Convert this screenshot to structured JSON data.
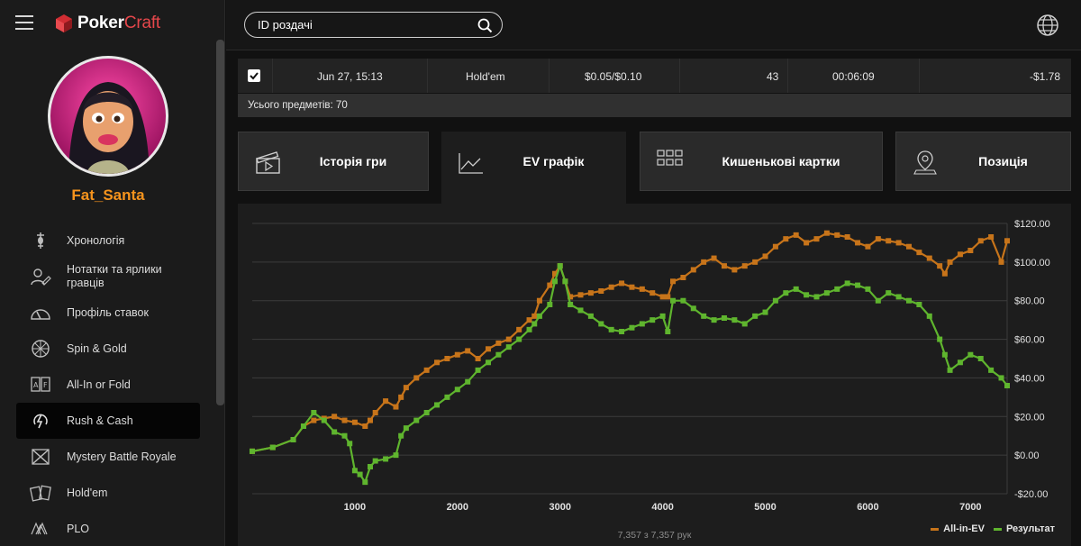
{
  "app": {
    "logo_primary": "Poker",
    "logo_accent": "Craft"
  },
  "profile": {
    "username": "Fat_Santa"
  },
  "sidebar": {
    "items": [
      {
        "label": "Хронологія",
        "icon": "hourglass-icon"
      },
      {
        "label": "Нотатки та ярлики гравців",
        "icon": "player-notes-icon"
      },
      {
        "label": "Профіль ставок",
        "icon": "gauge-icon"
      },
      {
        "label": "Spin & Gold",
        "icon": "spin-wheel-icon"
      },
      {
        "label": "All-In or Fold",
        "icon": "allin-cards-icon"
      },
      {
        "label": "Rush & Cash",
        "icon": "rush-icon",
        "active": true
      },
      {
        "label": "Mystery Battle Royale",
        "icon": "battle-royale-icon"
      },
      {
        "label": "Hold'em",
        "icon": "holdem-cards-icon"
      },
      {
        "label": "PLO",
        "icon": "plo-cards-icon"
      }
    ]
  },
  "search": {
    "placeholder": "ID роздачі"
  },
  "table": {
    "row": {
      "checked": true,
      "date": "Jun 27, 15:13",
      "game": "Hold'em",
      "stakes": "$0.05/$0.10",
      "hands": "43",
      "duration": "00:06:09",
      "result": "-$1.78"
    },
    "total_label": "Усього предметів: 70"
  },
  "tabs": [
    {
      "label": "Історія гри",
      "icon": "clapperboard-icon"
    },
    {
      "label": "EV графік",
      "icon": "line-chart-icon",
      "active": true
    },
    {
      "label": "Кишенькові картки",
      "icon": "grid-icon"
    },
    {
      "label": "Позиція",
      "icon": "location-pin-icon"
    }
  ],
  "colors": {
    "ev": "#c7741a",
    "result": "#5fb52e",
    "accent": "#f7941d"
  },
  "chart_data": {
    "type": "line",
    "x_ticks": [
      1000,
      2000,
      3000,
      4000,
      5000,
      6000,
      7000
    ],
    "y_ticks": [
      "$120.00",
      "$100.00",
      "$80.00",
      "$60.00",
      "$40.00",
      "$20.00",
      "$0.00",
      "-$20.00"
    ],
    "xlim": [
      0,
      7357
    ],
    "ylim": [
      -20,
      120
    ],
    "grid": true,
    "legend": "bottom-right",
    "footnote": "7,357 з 7,357 рук",
    "series": [
      {
        "name": "All-in-EV",
        "color": "#c7741a",
        "x": [
          0,
          200,
          400,
          500,
          600,
          700,
          800,
          900,
          1000,
          1100,
          1150,
          1200,
          1300,
          1400,
          1450,
          1500,
          1600,
          1700,
          1800,
          1900,
          2000,
          2100,
          2200,
          2300,
          2400,
          2500,
          2600,
          2700,
          2750,
          2800,
          2900,
          2950,
          3000,
          3050,
          3100,
          3200,
          3300,
          3400,
          3500,
          3600,
          3700,
          3800,
          3900,
          4000,
          4050,
          4100,
          4200,
          4300,
          4400,
          4500,
          4600,
          4700,
          4800,
          4900,
          5000,
          5100,
          5200,
          5300,
          5400,
          5500,
          5600,
          5700,
          5800,
          5900,
          6000,
          6100,
          6200,
          6300,
          6400,
          6500,
          6600,
          6700,
          6750,
          6800,
          6900,
          7000,
          7100,
          7200,
          7300,
          7357
        ],
        "y": [
          2,
          4,
          8,
          15,
          18,
          19,
          20,
          18,
          17,
          15,
          18,
          22,
          28,
          25,
          30,
          35,
          40,
          44,
          48,
          50,
          52,
          54,
          50,
          55,
          58,
          60,
          65,
          70,
          72,
          80,
          88,
          94,
          98,
          90,
          82,
          83,
          84,
          85,
          87,
          89,
          87,
          86,
          84,
          82,
          82,
          90,
          92,
          96,
          100,
          102,
          98,
          96,
          98,
          100,
          103,
          108,
          112,
          114,
          110,
          112,
          115,
          114,
          113,
          110,
          108,
          112,
          111,
          110,
          108,
          105,
          102,
          98,
          94,
          100,
          104,
          106,
          111,
          113,
          100,
          111
        ]
      },
      {
        "name": "Результат",
        "color": "#5fb52e",
        "x": [
          0,
          200,
          400,
          500,
          600,
          700,
          800,
          900,
          950,
          1000,
          1050,
          1100,
          1150,
          1200,
          1300,
          1400,
          1450,
          1500,
          1600,
          1700,
          1800,
          1900,
          2000,
          2100,
          2200,
          2300,
          2400,
          2500,
          2600,
          2700,
          2750,
          2800,
          2900,
          2950,
          3000,
          3050,
          3100,
          3200,
          3300,
          3400,
          3500,
          3600,
          3700,
          3800,
          3900,
          4000,
          4050,
          4100,
          4200,
          4300,
          4400,
          4500,
          4600,
          4700,
          4800,
          4900,
          5000,
          5100,
          5200,
          5300,
          5400,
          5500,
          5600,
          5700,
          5800,
          5900,
          6000,
          6100,
          6200,
          6300,
          6400,
          6500,
          6600,
          6700,
          6750,
          6800,
          6900,
          7000,
          7100,
          7200,
          7300,
          7357
        ],
        "y": [
          2,
          4,
          8,
          15,
          22,
          18,
          12,
          10,
          6,
          -8,
          -10,
          -14,
          -6,
          -3,
          -2,
          0,
          10,
          14,
          18,
          22,
          26,
          30,
          34,
          38,
          44,
          48,
          52,
          56,
          60,
          65,
          68,
          72,
          78,
          90,
          98,
          90,
          78,
          75,
          72,
          68,
          65,
          64,
          66,
          68,
          70,
          72,
          64,
          80,
          80,
          76,
          72,
          70,
          71,
          70,
          68,
          72,
          74,
          80,
          84,
          86,
          83,
          82,
          84,
          86,
          89,
          88,
          86,
          80,
          84,
          82,
          80,
          78,
          72,
          60,
          52,
          44,
          48,
          52,
          50,
          44,
          40,
          36
        ]
      }
    ]
  }
}
